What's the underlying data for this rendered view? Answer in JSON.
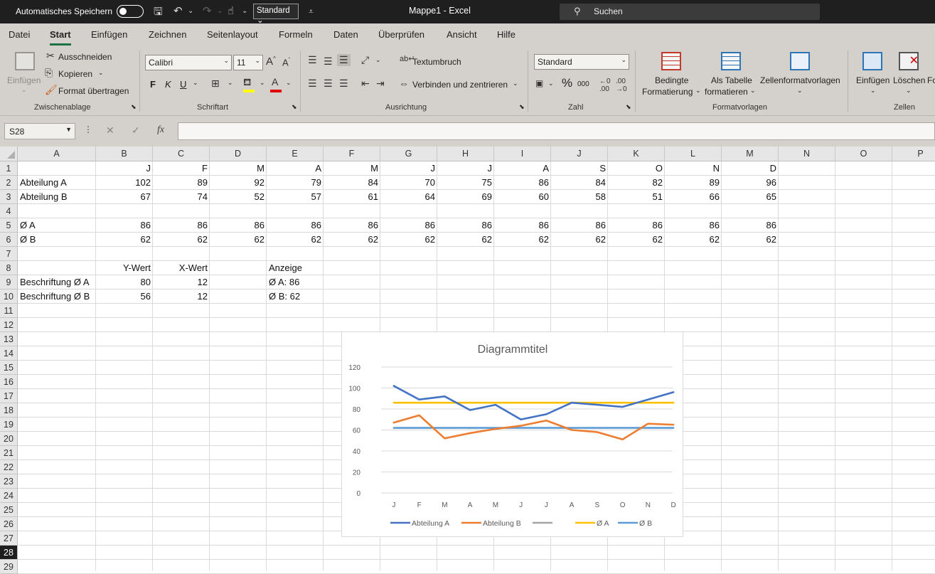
{
  "titlebar": {
    "autosave_label": "Automatisches Speichern",
    "style_dropdown": "Standard",
    "doc_title": "Mappe1  -  Excel",
    "search_placeholder": "Suchen"
  },
  "menu": {
    "tabs": [
      "Datei",
      "Start",
      "Einfügen",
      "Zeichnen",
      "Seitenlayout",
      "Formeln",
      "Daten",
      "Überprüfen",
      "Ansicht",
      "Hilfe"
    ],
    "active_tab": "Start"
  },
  "ribbon": {
    "clipboard": {
      "paste": "Einfügen",
      "cut": "Ausschneiden",
      "copy": "Kopieren",
      "format_painter": "Format übertragen",
      "group_label": "Zwischenablage"
    },
    "font": {
      "font_name": "Calibri",
      "font_size": "11",
      "bold": "F",
      "italic": "K",
      "underline": "U",
      "group_label": "Schriftart"
    },
    "alignment": {
      "wrap_text": "Textumbruch",
      "merge_center": "Verbinden und zentrieren",
      "group_label": "Ausrichtung"
    },
    "number": {
      "format": "Standard",
      "percent": "%",
      "thousands": "000",
      "group_label": "Zahl"
    },
    "styles": {
      "conditional_1": "Bedingte",
      "conditional_2": "Formatierung",
      "as_table_1": "Als Tabelle",
      "as_table_2": "formatieren",
      "cell_styles": "Zellenformatvorlagen",
      "group_label": "Formatvorlagen"
    },
    "cells": {
      "insert": "Einfügen",
      "delete": "Löschen",
      "format_partial": "Fo",
      "group_label": "Zellen"
    }
  },
  "formula_bar": {
    "name_box": "S28",
    "fx": "fx",
    "formula": ""
  },
  "columns": [
    "A",
    "B",
    "C",
    "D",
    "E",
    "F",
    "G",
    "H",
    "I",
    "J",
    "K",
    "L",
    "M",
    "N",
    "O",
    "P"
  ],
  "rows": [
    "1",
    "2",
    "3",
    "4",
    "5",
    "6",
    "7",
    "8",
    "9",
    "10",
    "11",
    "12",
    "13",
    "14",
    "15",
    "16",
    "17",
    "18",
    "19",
    "20",
    "21",
    "22",
    "23",
    "24",
    "25",
    "26",
    "27",
    "28",
    "29"
  ],
  "selected_row": "28",
  "cells": {
    "months": [
      "J",
      "F",
      "M",
      "A",
      "M",
      "J",
      "J",
      "A",
      "S",
      "O",
      "N",
      "D"
    ],
    "abteilung_a_label": "Abteilung A",
    "abteilung_a": [
      102,
      89,
      92,
      79,
      84,
      70,
      75,
      86,
      84,
      82,
      89,
      96
    ],
    "abteilung_b_label": "Abteilung B",
    "abteilung_b": [
      67,
      74,
      52,
      57,
      61,
      64,
      69,
      60,
      58,
      51,
      66,
      65
    ],
    "avg_a_label": "Ø A",
    "avg_a": [
      86,
      86,
      86,
      86,
      86,
      86,
      86,
      86,
      86,
      86,
      86,
      86
    ],
    "avg_b_label": "Ø B",
    "avg_b": [
      62,
      62,
      62,
      62,
      62,
      62,
      62,
      62,
      62,
      62,
      62,
      62
    ],
    "y_header": "Y-Wert",
    "x_header": "X-Wert",
    "display_header": "Anzeige",
    "label_a": "Beschriftung Ø A",
    "label_a_y": "80",
    "label_a_x": "12",
    "label_a_display": "Ø A: 86",
    "label_b": "Beschriftung Ø B",
    "label_b_y": "56",
    "label_b_x": "12",
    "label_b_display": "Ø B: 62"
  },
  "chart_data": {
    "type": "line",
    "title": "Diagrammtitel",
    "categories": [
      "J",
      "F",
      "M",
      "A",
      "M",
      "J",
      "J",
      "A",
      "S",
      "O",
      "N",
      "D"
    ],
    "ylim": [
      0,
      120
    ],
    "yticks": [
      0,
      20,
      40,
      60,
      80,
      100,
      120
    ],
    "grid": true,
    "legend_position": "bottom",
    "series": [
      {
        "name": "Abteilung A",
        "color": "#4472c4",
        "values": [
          102,
          89,
          92,
          79,
          84,
          70,
          75,
          86,
          84,
          82,
          89,
          96
        ]
      },
      {
        "name": "Abteilung B",
        "color": "#ed7d31",
        "values": [
          67,
          74,
          52,
          57,
          61,
          64,
          69,
          60,
          58,
          51,
          66,
          65
        ]
      },
      {
        "name": "",
        "color": "#a5a5a5",
        "values": []
      },
      {
        "name": "Ø A",
        "color": "#ffc000",
        "values": [
          86,
          86,
          86,
          86,
          86,
          86,
          86,
          86,
          86,
          86,
          86,
          86
        ]
      },
      {
        "name": "Ø B",
        "color": "#5b9bd5",
        "values": [
          62,
          62,
          62,
          62,
          62,
          62,
          62,
          62,
          62,
          62,
          62,
          62
        ]
      }
    ]
  }
}
